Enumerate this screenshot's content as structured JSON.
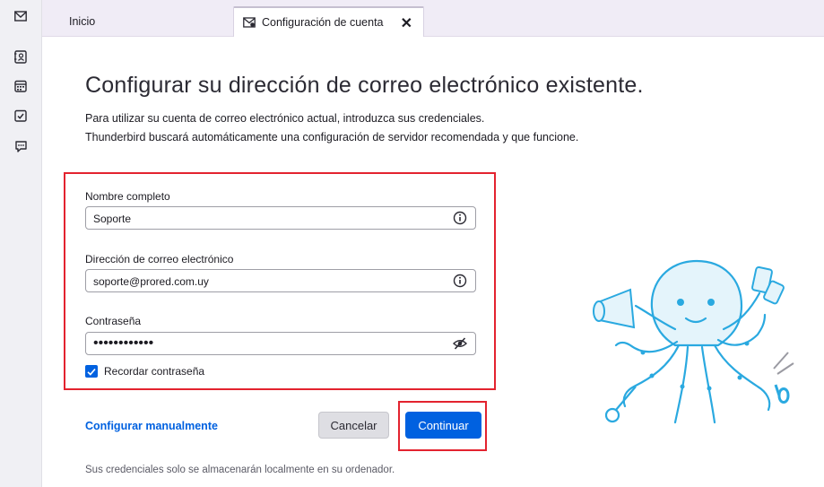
{
  "sidebar": {
    "icons": [
      "mail-icon",
      "address-book-icon",
      "calendar-icon",
      "tasks-icon",
      "chat-icon"
    ]
  },
  "tabs": {
    "home_label": "Inicio",
    "active_label": "Configuración de cuenta",
    "close_glyph": "✕"
  },
  "page": {
    "title": "Configurar su dirección de correo electrónico existente.",
    "desc1": "Para utilizar su cuenta de correo electrónico actual, introduzca sus credenciales.",
    "desc2": "Thunderbird buscará automáticamente una configuración de servidor recomendada y que funcione."
  },
  "form": {
    "name_label": "Nombre completo",
    "name_value": "Soporte",
    "email_label": "Dirección de correo electrónico",
    "email_value": "soporte@prored.com.uy",
    "password_label": "Contraseña",
    "password_value": "••••••••••••",
    "remember_label": "Recordar contraseña",
    "remember_checked": true
  },
  "actions": {
    "manual_link": "Configurar manualmente",
    "cancel_label": "Cancelar",
    "continue_label": "Continuar"
  },
  "footer": {
    "note": "Sus credenciales solo se almacenarán localmente en su ordenador."
  },
  "colors": {
    "accent": "#0061e0",
    "highlight_border": "#e3232f"
  }
}
